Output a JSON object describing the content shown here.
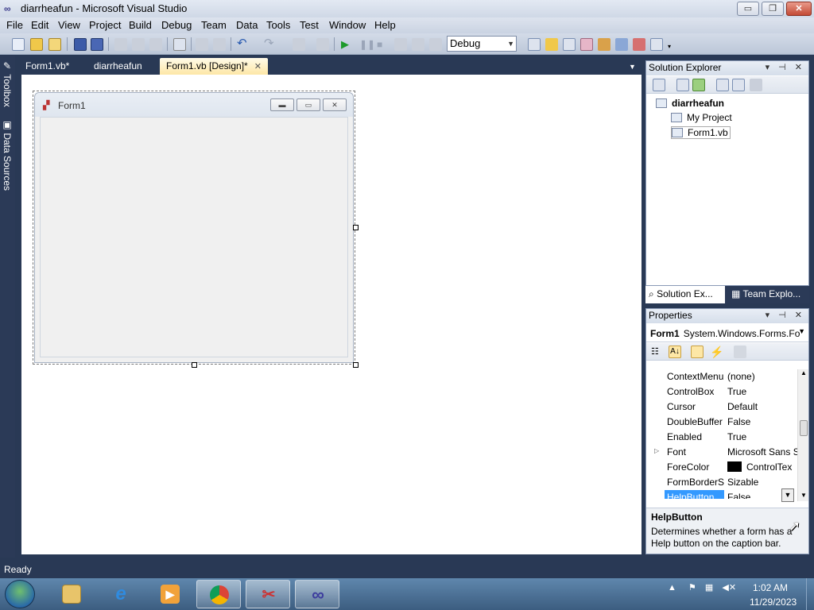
{
  "window": {
    "title": "diarrheafun - Microsoft Visual Studio",
    "min": "▭",
    "max": "❐",
    "close": "✕"
  },
  "menu": [
    "File",
    "Edit",
    "View",
    "Project",
    "Build",
    "Debug",
    "Team",
    "Data",
    "Tools",
    "Test",
    "Window",
    "Help"
  ],
  "toolbar": {
    "configuration": "Debug",
    "icons": [
      "new-project-icon",
      "open-icon",
      "add-item-icon",
      "save-icon",
      "save-all-icon",
      "cut-icon",
      "copy-icon",
      "paste-icon",
      "find-icon",
      "comment-icon",
      "uncomment-icon",
      "undo-icon",
      "redo-icon",
      "navigate-back-icon",
      "navigate-forward-icon",
      "start-icon",
      "pause-icon",
      "stop-icon",
      "step-icon"
    ]
  },
  "side_tabs": [
    "Toolbox",
    "Data Sources"
  ],
  "doc_tabs": [
    {
      "label": "Form1.vb*"
    },
    {
      "label": "diarrheafun"
    },
    {
      "label": "Form1.vb [Design]*"
    }
  ],
  "designer": {
    "form_title": "Form1"
  },
  "solution_explorer": {
    "title": "Solution Explorer",
    "items": [
      {
        "label": "diarrheafun"
      },
      {
        "label": "My Project"
      },
      {
        "label": "Form1.vb"
      }
    ],
    "tabs": [
      "Solution Ex...",
      "Team Explo..."
    ]
  },
  "properties": {
    "title": "Properties",
    "object_name": "Form1",
    "object_type": "System.Windows.Forms.Fo",
    "rows": [
      {
        "name": "ContextMenu",
        "value": "(none)"
      },
      {
        "name": "ControlBox",
        "value": "True"
      },
      {
        "name": "Cursor",
        "value": "Default"
      },
      {
        "name": "DoubleBuffer",
        "value": "False"
      },
      {
        "name": "Enabled",
        "value": "True"
      },
      {
        "name": "Font",
        "value": "Microsoft Sans S"
      },
      {
        "name": "ForeColor",
        "value": "ControlTex"
      },
      {
        "name": "FormBorderSt",
        "value": "Sizable"
      },
      {
        "name": "HelpButton",
        "value": "False"
      }
    ],
    "description_title": "HelpButton",
    "description": "Determines whether a form has a Help button on the caption bar."
  },
  "status": "Ready",
  "taskbar": {
    "time": "1:02 AM",
    "date": "11/29/2023"
  },
  "colors": {
    "chrome": "#293955",
    "selection": "#3399ff",
    "active_tab": "#fde7a6"
  }
}
